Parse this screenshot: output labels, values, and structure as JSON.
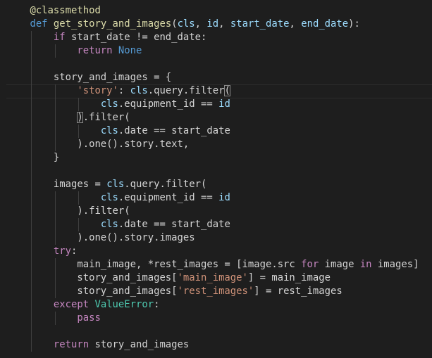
{
  "editor": {
    "language": "python",
    "theme": "dark",
    "colors": {
      "background": "#1e1e1e",
      "plain": "#d4d4d4",
      "variable": "#9cdcfe",
      "function": "#dcdcaa",
      "string": "#ce9178",
      "keyword": "#569cd6",
      "control": "#c586c0",
      "class": "#4ec9b0"
    },
    "lines": [
      [
        [
          "    ",
          "plain"
        ],
        [
          "@classmethod",
          "dec"
        ]
      ],
      [
        [
          "    ",
          "plain"
        ],
        [
          "def",
          "kw"
        ],
        [
          " ",
          "plain"
        ],
        [
          "get_story_and_images",
          "fn"
        ],
        [
          "(",
          "plain"
        ],
        [
          "cls",
          "var"
        ],
        [
          ", ",
          "plain"
        ],
        [
          "id",
          "var"
        ],
        [
          ", ",
          "plain"
        ],
        [
          "start_date",
          "var"
        ],
        [
          ", ",
          "plain"
        ],
        [
          "end_date",
          "var"
        ],
        [
          "):",
          "plain"
        ]
      ],
      [
        [
          "        ",
          "plain"
        ],
        [
          "if",
          "ctrl"
        ],
        [
          " start_date != end_date:",
          "plain"
        ]
      ],
      [
        [
          "            ",
          "plain"
        ],
        [
          "return",
          "ctrl"
        ],
        [
          " ",
          "plain"
        ],
        [
          "None",
          "kw"
        ]
      ],
      [],
      [
        [
          "        ",
          "plain"
        ],
        [
          "story_and_images = {",
          "plain"
        ]
      ],
      [
        [
          "            ",
          "plain"
        ],
        [
          "'story'",
          "str"
        ],
        [
          ": ",
          "plain"
        ],
        [
          "cls",
          "var"
        ],
        [
          ".query.filter",
          "plain"
        ],
        [
          "(",
          "bracket"
        ]
      ],
      [
        [
          "                ",
          "plain"
        ],
        [
          "cls",
          "var"
        ],
        [
          ".equipment_id == ",
          "plain"
        ],
        [
          "id",
          "var"
        ]
      ],
      [
        [
          "            ",
          "plain"
        ],
        [
          ")",
          "bracket"
        ],
        [
          ".filter(",
          "plain"
        ]
      ],
      [
        [
          "                ",
          "plain"
        ],
        [
          "cls",
          "var"
        ],
        [
          ".date == start_date",
          "plain"
        ]
      ],
      [
        [
          "            ",
          "plain"
        ],
        [
          ").one().story.text,",
          "plain"
        ]
      ],
      [
        [
          "        ",
          "plain"
        ],
        [
          "}",
          "plain"
        ]
      ],
      [],
      [
        [
          "        ",
          "plain"
        ],
        [
          "images = ",
          "plain"
        ],
        [
          "cls",
          "var"
        ],
        [
          ".query.filter(",
          "plain"
        ]
      ],
      [
        [
          "                ",
          "plain"
        ],
        [
          "cls",
          "var"
        ],
        [
          ".equipment_id == ",
          "plain"
        ],
        [
          "id",
          "var"
        ]
      ],
      [
        [
          "            ",
          "plain"
        ],
        [
          ").filter(",
          "plain"
        ]
      ],
      [
        [
          "                ",
          "plain"
        ],
        [
          "cls",
          "var"
        ],
        [
          ".date == start_date",
          "plain"
        ]
      ],
      [
        [
          "            ",
          "plain"
        ],
        [
          ").one().story.images",
          "plain"
        ]
      ],
      [
        [
          "        ",
          "plain"
        ],
        [
          "try",
          "ctrl"
        ],
        [
          ":",
          "plain"
        ]
      ],
      [
        [
          "            ",
          "plain"
        ],
        [
          "main_image, *rest_images = [image.src ",
          "plain"
        ],
        [
          "for",
          "ctrl"
        ],
        [
          " image ",
          "plain"
        ],
        [
          "in",
          "ctrl"
        ],
        [
          " images]",
          "plain"
        ]
      ],
      [
        [
          "            ",
          "plain"
        ],
        [
          "story_and_images[",
          "plain"
        ],
        [
          "'main_image'",
          "str"
        ],
        [
          "] = main_image",
          "plain"
        ]
      ],
      [
        [
          "            ",
          "plain"
        ],
        [
          "story_and_images[",
          "plain"
        ],
        [
          "'rest_images'",
          "str"
        ],
        [
          "] = rest_images",
          "plain"
        ]
      ],
      [
        [
          "        ",
          "plain"
        ],
        [
          "except",
          "ctrl"
        ],
        [
          " ",
          "plain"
        ],
        [
          "ValueError",
          "cls"
        ],
        [
          ":",
          "plain"
        ]
      ],
      [
        [
          "            ",
          "plain"
        ],
        [
          "pass",
          "ctrl"
        ]
      ],
      [],
      [
        [
          "        ",
          "plain"
        ],
        [
          "return",
          "ctrl"
        ],
        [
          " story_and_images",
          "plain"
        ]
      ]
    ]
  }
}
